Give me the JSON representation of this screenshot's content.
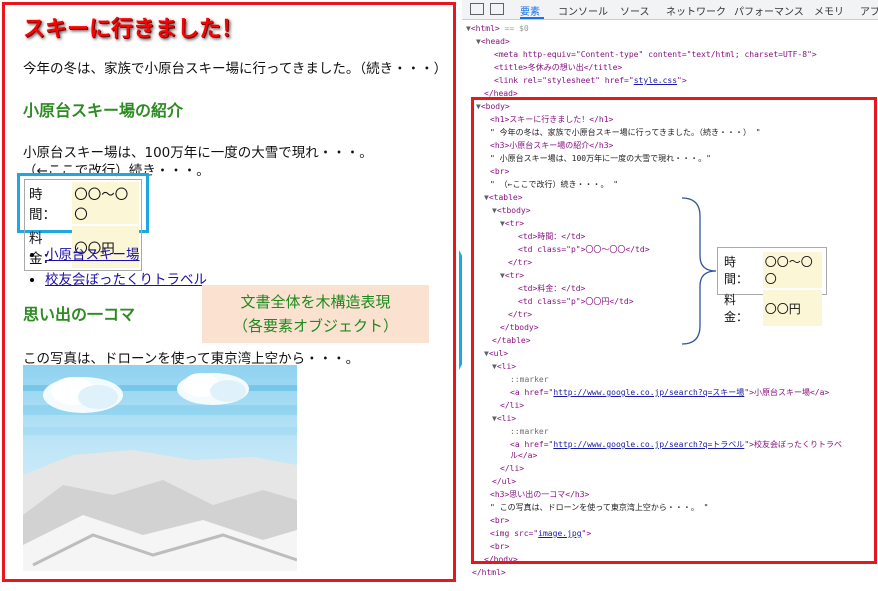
{
  "page": {
    "h1": "スキーに行きました！",
    "intro": "今年の冬は、家族で小原台スキー場に行ってきました。（続き・・・）",
    "h3_resort": "小原台スキー場の紹介",
    "resort_text1": "小原台スキー場は、100万年に一度の大雪で現れ・・・。",
    "resort_text2": "（←ここで改行）続き・・・。",
    "table": [
      {
        "label": "時間：",
        "value": "〇〇～〇〇"
      },
      {
        "label": "料金：",
        "value": "〇〇円"
      }
    ],
    "links": [
      "小原台スキー場",
      "校友会ぼったくりトラベル"
    ],
    "h3_memory": "思い出の一コマ",
    "memory_text": "この写真は、ドローンを使って東京湾上空から・・・。"
  },
  "caption": {
    "line1": "文書全体を木構造表現",
    "line2": "（各要素オブジェクト）"
  },
  "devtools": {
    "tabs": [
      "要素",
      "コンソール",
      "ソース",
      "ネットワーク",
      "パフォーマンス",
      "メモリ",
      "アプ"
    ],
    "active_tab": "要素",
    "lines": {
      "html_open": "<html>",
      "html_eq": " == $0",
      "head_open": "<head>",
      "meta": "<meta http-equiv=\"Content-type\" content=\"text/html; charset=UTF-8\">",
      "title": "<title>冬休みの想い出</title>",
      "link_pre": "<link rel=\"stylesheet\" href=\"",
      "link_href": "style.css",
      "link_post": "\">",
      "head_close": "</head>",
      "body_open": "<body>",
      "h1": "<h1>スキーに行きました！</h1>",
      "text_intro": "\" 今年の冬は、家族で小原台スキー場に行ってきました。（続き・・・） \"",
      "h3_1": "<h3>小原台スキー場の紹介</h3>",
      "text_resort": "\" 小原台スキー場は、100万年に一度の大雪で現れ・・・。\"",
      "br1": "<br>",
      "text_cont": "\" （←ここで改行）続き・・・。 \"",
      "table_open": "<table>",
      "tbody_open": "<tbody>",
      "tr_open1": "<tr>",
      "td_time": "<td>時間：</td>",
      "td_time_val": "<td class=\"p\">〇〇～〇〇</td>",
      "tr_close1": "</tr>",
      "tr_open2": "<tr>",
      "td_fee": "<td>料金：</td>",
      "td_fee_val": "<td class=\"p\">〇〇円</td>",
      "tr_close2": "</tr>",
      "tbody_close": "</tbody>",
      "table_close": "</table>",
      "ul_open": "<ul>",
      "li_open1": "<li>",
      "marker1": "::marker",
      "a1_pre": "<a href=\"",
      "a1_href": "http://www.google.co.jp/search?q=スキー場",
      "a1_post": "\">小原台スキー場</a>",
      "li_close1": "</li>",
      "li_open2": "<li>",
      "marker2": "::marker",
      "a2_pre": "<a href=\"",
      "a2_href": "http://www.google.co.jp/search?q=トラベル",
      "a2_post": "\">校友会ぼったくりトラベ",
      "a2_wrap": "ル</a>",
      "li_close2": "</li>",
      "ul_close": "</ul>",
      "h3_2": "<h3>思い出の一コマ</h3>",
      "text_memory": "\" この写真は、ドローンを使って東京湾上空から・・・。 \"",
      "br2": "<br>",
      "img_pre": "<img src=\"",
      "img_src": "image.jpg",
      "img_post": "\">",
      "br3": "<br>",
      "body_close": "</body>",
      "html_close": "</html>"
    }
  },
  "colors": {
    "frame_red": "#e8161f",
    "table_blue": "#1ea7e0",
    "arrow_blue": "#1aa9e8",
    "heading_green": "#2e8b22",
    "caption_bg": "#fbe2d0"
  }
}
